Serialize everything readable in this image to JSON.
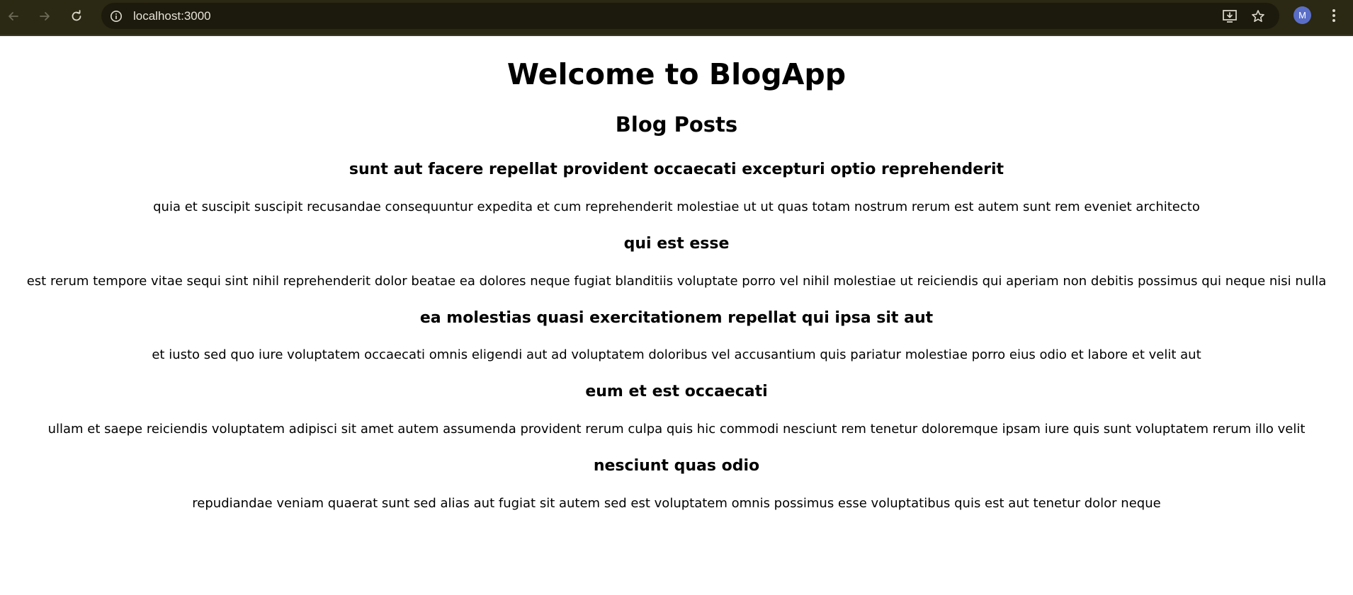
{
  "browser": {
    "url": "localhost:3000",
    "profile_initial": "M"
  },
  "page": {
    "heading": "Welcome to BlogApp",
    "subheading": "Blog Posts",
    "posts": [
      {
        "title": "sunt aut facere repellat provident occaecati excepturi optio reprehenderit",
        "body": "quia et suscipit suscipit recusandae consequuntur expedita et cum reprehenderit molestiae ut ut quas totam nostrum rerum est autem sunt rem eveniet architecto"
      },
      {
        "title": "qui est esse",
        "body": "est rerum tempore vitae sequi sint nihil reprehenderit dolor beatae ea dolores neque fugiat blanditiis voluptate porro vel nihil molestiae ut reiciendis qui aperiam non debitis possimus qui neque nisi nulla"
      },
      {
        "title": "ea molestias quasi exercitationem repellat qui ipsa sit aut",
        "body": "et iusto sed quo iure voluptatem occaecati omnis eligendi aut ad voluptatem doloribus vel accusantium quis pariatur molestiae porro eius odio et labore et velit aut"
      },
      {
        "title": "eum et est occaecati",
        "body": "ullam et saepe reiciendis voluptatem adipisci sit amet autem assumenda provident rerum culpa quis hic commodi nesciunt rem tenetur doloremque ipsam iure quis sunt voluptatem rerum illo velit"
      },
      {
        "title": "nesciunt quas odio",
        "body": "repudiandae veniam quaerat sunt sed alias aut fugiat sit autem sed est voluptatem omnis possimus esse voluptatibus quis est aut tenetur dolor neque"
      }
    ]
  },
  "icons": {
    "back": "arrow-left-icon",
    "forward": "arrow-right-icon",
    "reload": "reload-icon",
    "site_info": "info-icon",
    "install": "install-app-icon",
    "bookmark": "star-icon",
    "menu": "kebab-menu-icon"
  },
  "colors": {
    "chrome_bg": "#2b2813",
    "omnibox_bg": "#1c1a0c",
    "avatar": "#5a6ec7"
  }
}
